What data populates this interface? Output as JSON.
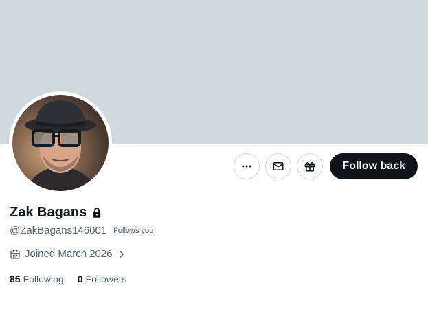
{
  "profile": {
    "display_name": "Zak Bagans",
    "handle": "@ZakBagans146001",
    "follows_you_badge": "Follows you",
    "joined": "Joined March 2026",
    "following_count": "85",
    "following_label": "Following",
    "followers_count": "0",
    "followers_label": "Followers"
  },
  "actions": {
    "more_icon": "more-horizontal-icon",
    "message_icon": "envelope-icon",
    "gift_icon": "gift-icon",
    "follow_back_label": "Follow back"
  },
  "colors": {
    "banner": "#cfd9de",
    "primary_text": "#0f1419",
    "secondary_text": "#536471",
    "button_dark": "#0f1419"
  }
}
